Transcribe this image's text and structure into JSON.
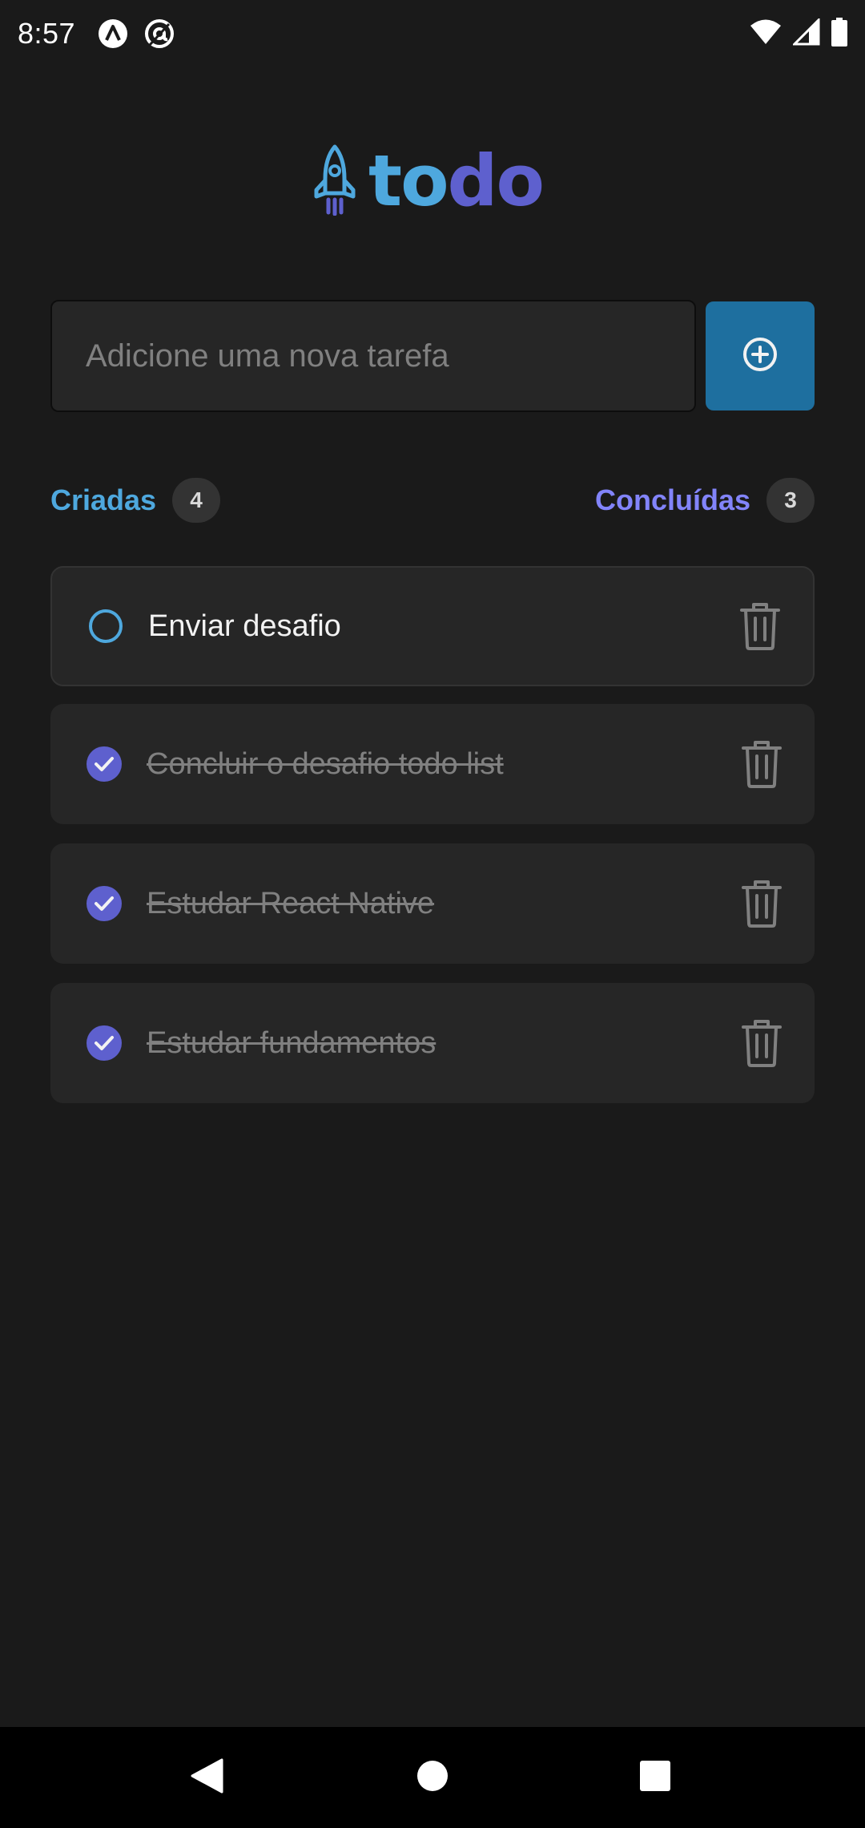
{
  "status_bar": {
    "time": "8:57",
    "icons": [
      "app-a-icon",
      "app-at-icon",
      "wifi-icon",
      "signal-icon",
      "battery-icon"
    ]
  },
  "logo": {
    "icon": "rocket-icon",
    "text_part1": "to",
    "text_part2": "do",
    "colors": {
      "part1": "#4ea8de",
      "part2": "#5e60ce"
    }
  },
  "new_task": {
    "placeholder": "Adicione uma nova tarefa",
    "value": "",
    "add_button_icon": "plus-circle-icon",
    "button_color": "#1e6f9f"
  },
  "counters": {
    "created_label": "Criadas",
    "created_count": "4",
    "done_label": "Concluídas",
    "done_count": "3"
  },
  "tasks": [
    {
      "text": "Enviar desafio",
      "completed": false
    },
    {
      "text": "Concluir o desafio todo list",
      "completed": true
    },
    {
      "text": "Estudar React Native",
      "completed": true
    },
    {
      "text": "Estudar fundamentos",
      "completed": true
    }
  ],
  "colors": {
    "background": "#1a1a1a",
    "card": "#262626",
    "blue": "#4ea8de",
    "purple": "#5e60ce",
    "purple_light": "#8284fa"
  },
  "nav": {
    "icons": [
      "back-icon",
      "home-icon",
      "recents-icon"
    ]
  }
}
